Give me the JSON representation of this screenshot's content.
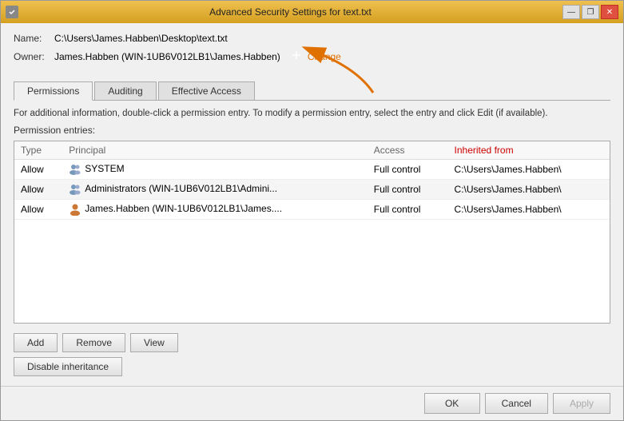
{
  "window": {
    "title": "Advanced Security Settings for text.txt",
    "icon_label": "shield"
  },
  "title_buttons": {
    "minimize": "—",
    "restore": "❐",
    "close": "✕"
  },
  "fields": {
    "name_label": "Name:",
    "name_value": "C:\\Users\\James.Habben\\Desktop\\text.txt",
    "owner_label": "Owner:",
    "owner_value": "James.Habben (WIN-1UB6V012LB1\\James.Habben)",
    "change_label": "Change"
  },
  "tabs": [
    {
      "id": "permissions",
      "label": "Permissions",
      "active": true
    },
    {
      "id": "auditing",
      "label": "Auditing",
      "active": false
    },
    {
      "id": "effective-access",
      "label": "Effective Access",
      "active": false
    }
  ],
  "info_text": "For additional information, double-click a permission entry. To modify a permission entry, select the entry and click Edit (if available).",
  "perm_entries_label": "Permission entries:",
  "table": {
    "columns": [
      {
        "id": "type",
        "label": "Type"
      },
      {
        "id": "principal",
        "label": "Principal"
      },
      {
        "id": "access",
        "label": "Access"
      },
      {
        "id": "inherited_from",
        "label": "Inherited from"
      }
    ],
    "rows": [
      {
        "type": "Allow",
        "principal": "SYSTEM",
        "access": "Full control",
        "inherited_from": "C:\\Users\\James.Habben\\"
      },
      {
        "type": "Allow",
        "principal": "Administrators (WIN-1UB6V012LB1\\Admini...",
        "access": "Full control",
        "inherited_from": "C:\\Users\\James.Habben\\"
      },
      {
        "type": "Allow",
        "principal": "James.Habben (WIN-1UB6V012LB1\\James....",
        "access": "Full control",
        "inherited_from": "C:\\Users\\James.Habben\\"
      }
    ]
  },
  "buttons": {
    "add": "Add",
    "remove": "Remove",
    "view": "View",
    "disable_inheritance": "Disable inheritance"
  },
  "footer_buttons": {
    "ok": "OK",
    "cancel": "Cancel",
    "apply": "Apply"
  },
  "colors": {
    "title_bar_start": "#f0c050",
    "title_bar_end": "#d4a020",
    "inherited_color": "#cc0000",
    "arrow_color": "#e07000",
    "change_color": "#e07000"
  }
}
